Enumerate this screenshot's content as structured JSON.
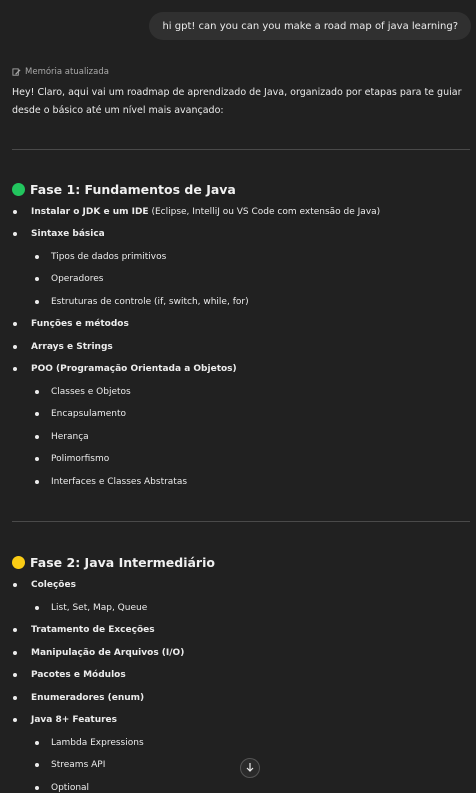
{
  "user_message": "hi gpt! can you can you make a road map of java learning?",
  "memory_label": "Memória atualizada",
  "intro": "Hey! Claro, aqui vai um roadmap de aprendizado de Java, organizado por etapas para te guiar desde o básico até um nível mais avançado:",
  "phase1": {
    "title": "Fase 1: Fundamentos de Java",
    "jdk_bold": "Instalar o JDK e um IDE",
    "jdk_rest": " (Eclipse, IntelliJ ou VS Code com extensão de Java)",
    "syntax": "Sintaxe básica",
    "syntax_items": [
      "Tipos de dados primitivos",
      "Operadores",
      "Estruturas de controle (if, switch, while, for)"
    ],
    "functions": "Funções e métodos",
    "arrays": "Arrays e Strings",
    "poo": "POO (Programação Orientada a Objetos)",
    "poo_items": [
      "Classes e Objetos",
      "Encapsulamento",
      "Herança",
      "Polimorfismo",
      "Interfaces e Classes Abstratas"
    ]
  },
  "phase2": {
    "title": "Fase 2: Java Intermediário",
    "collections": "Coleções",
    "collections_items": [
      "List, Set, Map, Queue"
    ],
    "exceptions": "Tratamento de Exceções",
    "files": "Manipulação de Arquivos (I/O)",
    "packages": "Pacotes e Módulos",
    "enums": "Enumeradores (enum)",
    "java8": "Java 8+ Features",
    "java8_items": [
      "Lambda Expressions",
      "Streams API",
      "Optional"
    ]
  },
  "colors": {
    "background": "#212121",
    "bubble": "#303030",
    "phase1_dot": "#22c55e",
    "phase2_dot": "#facc15"
  },
  "icons": {
    "memory": "pencil-icon",
    "scroll": "arrow-down-icon"
  }
}
